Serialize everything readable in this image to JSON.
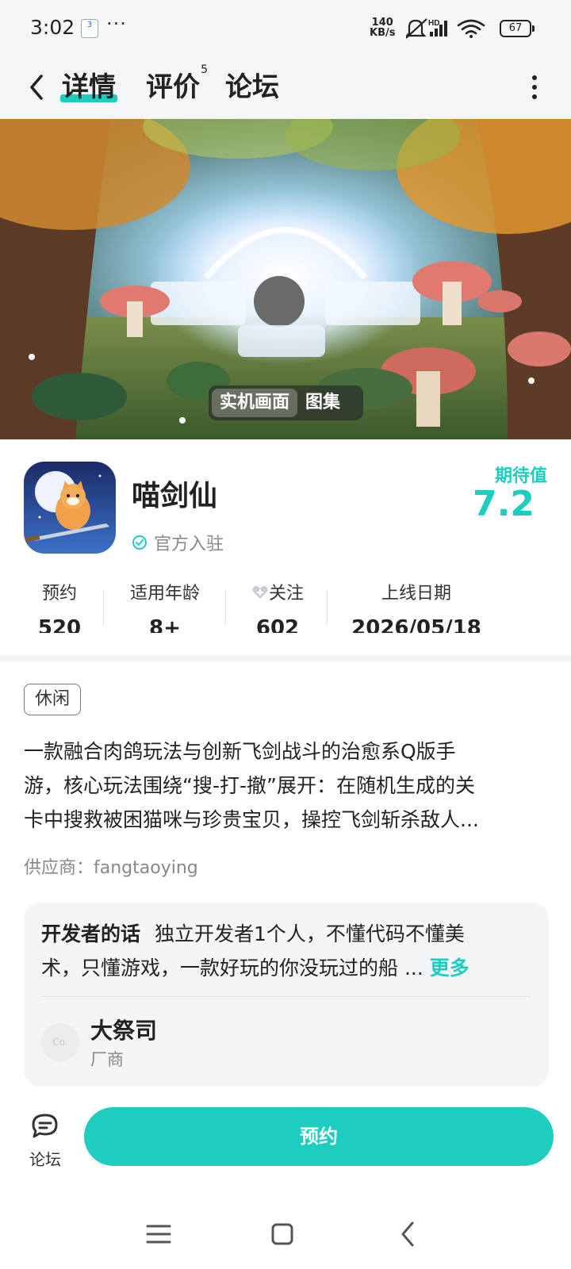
{
  "status_bar": {
    "time": "3:02",
    "notif_badge": "3",
    "more": "···",
    "net_speed_value": "140",
    "net_speed_unit": "KB/s",
    "hd_label": "HD",
    "battery": "67"
  },
  "nav": {
    "tabs": [
      {
        "label": "详情",
        "active": true
      },
      {
        "label": "评价",
        "badge": "5"
      },
      {
        "label": "论坛"
      }
    ]
  },
  "hero": {
    "segment_items": [
      "实机画面",
      "图集"
    ],
    "active_segment": 0
  },
  "app": {
    "name": "喵剑仙",
    "official_label": "官方入驻",
    "expect_label": "期待值",
    "expect_score": "7.2"
  },
  "stats": [
    {
      "label": "预约",
      "value": "520"
    },
    {
      "label": "适用年龄",
      "value": "8+"
    },
    {
      "label": "关注",
      "value": "602"
    },
    {
      "label": "上线日期",
      "value": "2026/05/18"
    }
  ],
  "tag": "休闲",
  "description_lines": [
    "一款融合肉鸽玩法与创新飞剑战斗的治愈系Q版手",
    "游，核心玩法围绕“搜-打-撤”展开：在随机生成的关",
    "卡中搜救被困猫咪与珍贵宝贝，操控飞剑斩杀敌人..."
  ],
  "supplier": "供应商：fangtaoying",
  "developer": {
    "title": "开发者的话",
    "text_line1": "独立开发者1个人，不懂代码不懂美",
    "text_line2": "术，只懂游戏，一款好玩的你没玩过的船 ...",
    "more_label": "更多",
    "avatar_text": "Co.",
    "name": "大祭司",
    "role": "厂商"
  },
  "bottom": {
    "forum_label": "论坛",
    "reserve_label": "预约"
  },
  "colors": {
    "accent": "#1ecdbf",
    "page_bg": "#ffffff",
    "bar_bg": "#f5f6f7"
  }
}
